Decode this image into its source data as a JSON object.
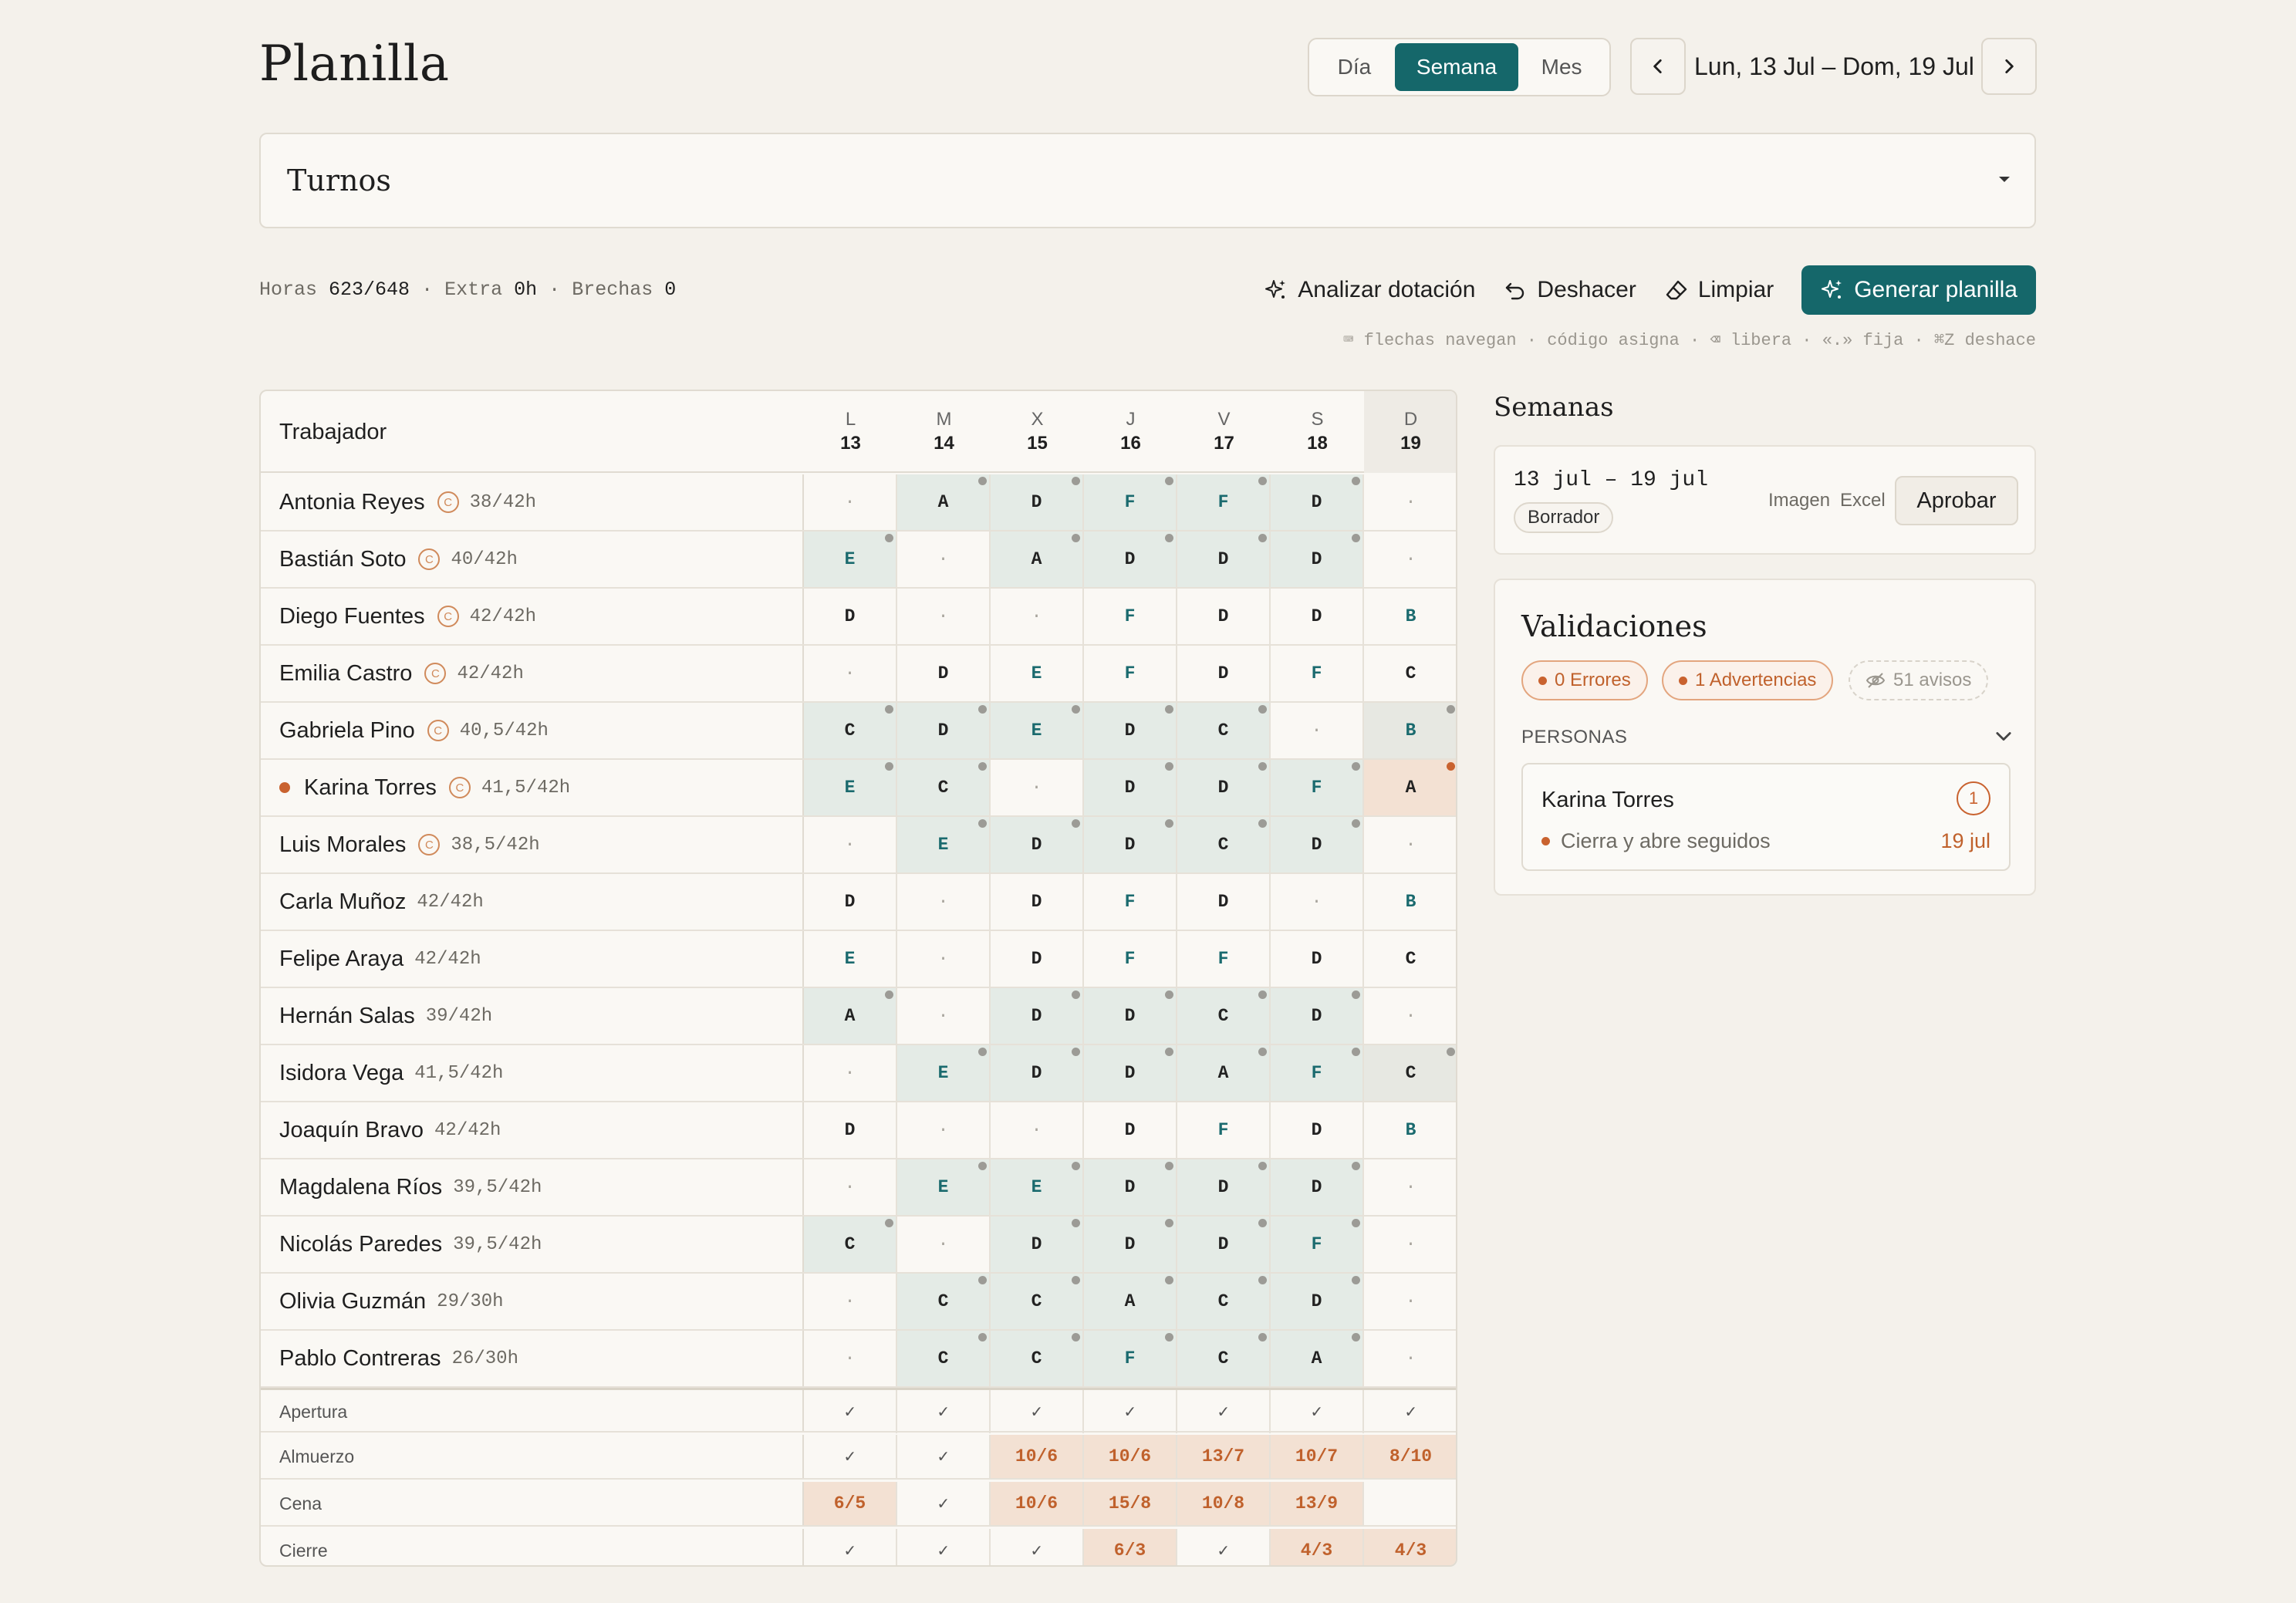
{
  "header": {
    "title": "Planilla",
    "view_options": [
      "Día",
      "Semana",
      "Mes"
    ],
    "selected_view": "Semana",
    "date_range": "Lun, 13 Jul – Dom, 19 Jul"
  },
  "turnos": {
    "label": "Turnos"
  },
  "stats": {
    "horas_label": "Horas",
    "horas_value": "623/648",
    "extra_label": "Extra",
    "extra_value": "0h",
    "brechas_label": "Brechas",
    "brechas_value": "0",
    "separator": "·"
  },
  "toolbar": {
    "analizar": "Analizar dotación",
    "deshacer": "Deshacer",
    "limpiar": "Limpiar",
    "generar": "Generar planilla",
    "hint": "⌨ flechas navegan · código asigna · ⌫ libera · «.» fija · ⌘Z deshace"
  },
  "grid": {
    "worker_header": "Trabajador",
    "days": [
      {
        "letter": "L",
        "num": "13"
      },
      {
        "letter": "M",
        "num": "14"
      },
      {
        "letter": "X",
        "num": "15"
      },
      {
        "letter": "J",
        "num": "16"
      },
      {
        "letter": "V",
        "num": "17"
      },
      {
        "letter": "S",
        "num": "18"
      },
      {
        "letter": "D",
        "num": "19"
      }
    ],
    "workers": [
      {
        "name": "Antonia Reyes",
        "contract": "C",
        "hours": "38/42h",
        "flag": false,
        "cells": [
          [
            "·",
            0,
            0,
            "e"
          ],
          [
            "A",
            1,
            1,
            "d"
          ],
          [
            "D",
            1,
            1,
            "d"
          ],
          [
            "F",
            1,
            1,
            "t"
          ],
          [
            "F",
            1,
            1,
            "t"
          ],
          [
            "D",
            1,
            1,
            "d"
          ],
          [
            "·",
            0,
            0,
            "e"
          ]
        ]
      },
      {
        "name": "Bastián Soto",
        "contract": "C",
        "hours": "40/42h",
        "flag": false,
        "cells": [
          [
            "E",
            1,
            1,
            "t"
          ],
          [
            "·",
            0,
            0,
            "e"
          ],
          [
            "A",
            1,
            1,
            "d"
          ],
          [
            "D",
            1,
            1,
            "d"
          ],
          [
            "D",
            1,
            1,
            "d"
          ],
          [
            "D",
            1,
            1,
            "d"
          ],
          [
            "·",
            0,
            0,
            "e"
          ]
        ]
      },
      {
        "name": "Diego Fuentes",
        "contract": "C",
        "hours": "42/42h",
        "flag": false,
        "cells": [
          [
            "D",
            0,
            0,
            "d"
          ],
          [
            "·",
            0,
            0,
            "e"
          ],
          [
            "·",
            0,
            0,
            "e"
          ],
          [
            "F",
            0,
            0,
            "t"
          ],
          [
            "D",
            0,
            0,
            "d"
          ],
          [
            "D",
            0,
            0,
            "d"
          ],
          [
            "B",
            0,
            0,
            "t"
          ]
        ]
      },
      {
        "name": "Emilia Castro",
        "contract": "C",
        "hours": "42/42h",
        "flag": false,
        "cells": [
          [
            "·",
            0,
            0,
            "e"
          ],
          [
            "D",
            0,
            0,
            "d"
          ],
          [
            "E",
            0,
            0,
            "t"
          ],
          [
            "F",
            0,
            0,
            "t"
          ],
          [
            "D",
            0,
            0,
            "d"
          ],
          [
            "F",
            0,
            0,
            "t"
          ],
          [
            "C",
            0,
            0,
            "d"
          ]
        ]
      },
      {
        "name": "Gabriela Pino",
        "contract": "C",
        "hours": "40,5/42h",
        "flag": false,
        "cells": [
          [
            "C",
            1,
            1,
            "d"
          ],
          [
            "D",
            1,
            1,
            "d"
          ],
          [
            "E",
            1,
            1,
            "t"
          ],
          [
            "D",
            1,
            1,
            "d"
          ],
          [
            "C",
            1,
            1,
            "d"
          ],
          [
            "·",
            0,
            0,
            "e"
          ],
          [
            "B",
            1,
            1,
            "t"
          ]
        ]
      },
      {
        "name": "Karina Torres",
        "contract": "C",
        "hours": "41,5/42h",
        "flag": true,
        "cells": [
          [
            "E",
            1,
            1,
            "t"
          ],
          [
            "C",
            1,
            1,
            "d"
          ],
          [
            "·",
            0,
            0,
            "e"
          ],
          [
            "D",
            1,
            1,
            "d"
          ],
          [
            "D",
            1,
            1,
            "d"
          ],
          [
            "F",
            1,
            1,
            "t"
          ],
          [
            "A",
            2,
            2,
            "d"
          ]
        ]
      },
      {
        "name": "Luis Morales",
        "contract": "C",
        "hours": "38,5/42h",
        "flag": false,
        "cells": [
          [
            "·",
            0,
            0,
            "e"
          ],
          [
            "E",
            1,
            1,
            "t"
          ],
          [
            "D",
            1,
            1,
            "d"
          ],
          [
            "D",
            1,
            1,
            "d"
          ],
          [
            "C",
            1,
            1,
            "d"
          ],
          [
            "D",
            1,
            1,
            "d"
          ],
          [
            "·",
            0,
            0,
            "e"
          ]
        ]
      },
      {
        "name": "Carla Muñoz",
        "contract": "",
        "hours": "42/42h",
        "flag": false,
        "cells": [
          [
            "D",
            0,
            0,
            "d"
          ],
          [
            "·",
            0,
            0,
            "e"
          ],
          [
            "D",
            0,
            0,
            "d"
          ],
          [
            "F",
            0,
            0,
            "t"
          ],
          [
            "D",
            0,
            0,
            "d"
          ],
          [
            "·",
            0,
            0,
            "e"
          ],
          [
            "B",
            0,
            0,
            "t"
          ]
        ]
      },
      {
        "name": "Felipe Araya",
        "contract": "",
        "hours": "42/42h",
        "flag": false,
        "cells": [
          [
            "E",
            0,
            0,
            "t"
          ],
          [
            "·",
            0,
            0,
            "e"
          ],
          [
            "D",
            0,
            0,
            "d"
          ],
          [
            "F",
            0,
            0,
            "t"
          ],
          [
            "F",
            0,
            0,
            "t"
          ],
          [
            "D",
            0,
            0,
            "d"
          ],
          [
            "C",
            0,
            0,
            "d"
          ]
        ]
      },
      {
        "name": "Hernán Salas",
        "contract": "",
        "hours": "39/42h",
        "flag": false,
        "cells": [
          [
            "A",
            1,
            1,
            "d"
          ],
          [
            "·",
            0,
            0,
            "e"
          ],
          [
            "D",
            1,
            1,
            "d"
          ],
          [
            "D",
            1,
            1,
            "d"
          ],
          [
            "C",
            1,
            1,
            "d"
          ],
          [
            "D",
            1,
            1,
            "d"
          ],
          [
            "·",
            0,
            0,
            "e"
          ]
        ]
      },
      {
        "name": "Isidora Vega",
        "contract": "",
        "hours": "41,5/42h",
        "flag": false,
        "cells": [
          [
            "·",
            0,
            0,
            "e"
          ],
          [
            "E",
            1,
            1,
            "t"
          ],
          [
            "D",
            1,
            1,
            "d"
          ],
          [
            "D",
            1,
            1,
            "d"
          ],
          [
            "A",
            1,
            1,
            "d"
          ],
          [
            "F",
            1,
            1,
            "t"
          ],
          [
            "C",
            1,
            1,
            "d"
          ]
        ]
      },
      {
        "name": "Joaquín Bravo",
        "contract": "",
        "hours": "42/42h",
        "flag": false,
        "cells": [
          [
            "D",
            0,
            0,
            "d"
          ],
          [
            "·",
            0,
            0,
            "e"
          ],
          [
            "·",
            0,
            0,
            "e"
          ],
          [
            "D",
            0,
            0,
            "d"
          ],
          [
            "F",
            0,
            0,
            "t"
          ],
          [
            "D",
            0,
            0,
            "d"
          ],
          [
            "B",
            0,
            0,
            "t"
          ]
        ]
      },
      {
        "name": "Magdalena Ríos",
        "contract": "",
        "hours": "39,5/42h",
        "flag": false,
        "cells": [
          [
            "·",
            0,
            0,
            "e"
          ],
          [
            "E",
            1,
            1,
            "t"
          ],
          [
            "E",
            1,
            1,
            "t"
          ],
          [
            "D",
            1,
            1,
            "d"
          ],
          [
            "D",
            1,
            1,
            "d"
          ],
          [
            "D",
            1,
            1,
            "d"
          ],
          [
            "·",
            0,
            0,
            "e"
          ]
        ]
      },
      {
        "name": "Nicolás Paredes",
        "contract": "",
        "hours": "39,5/42h",
        "flag": false,
        "cells": [
          [
            "C",
            1,
            1,
            "d"
          ],
          [
            "·",
            0,
            0,
            "e"
          ],
          [
            "D",
            1,
            1,
            "d"
          ],
          [
            "D",
            1,
            1,
            "d"
          ],
          [
            "D",
            1,
            1,
            "d"
          ],
          [
            "F",
            1,
            1,
            "t"
          ],
          [
            "·",
            0,
            0,
            "e"
          ]
        ]
      },
      {
        "name": "Olivia Guzmán",
        "contract": "",
        "hours": "29/30h",
        "flag": false,
        "cells": [
          [
            "·",
            0,
            0,
            "e"
          ],
          [
            "C",
            1,
            1,
            "d"
          ],
          [
            "C",
            1,
            1,
            "d"
          ],
          [
            "A",
            1,
            1,
            "d"
          ],
          [
            "C",
            1,
            1,
            "d"
          ],
          [
            "D",
            1,
            1,
            "d"
          ],
          [
            "·",
            0,
            0,
            "e"
          ]
        ]
      },
      {
        "name": "Pablo Contreras",
        "contract": "",
        "hours": "26/30h",
        "flag": false,
        "cells": [
          [
            "·",
            0,
            0,
            "e"
          ],
          [
            "C",
            1,
            1,
            "d"
          ],
          [
            "C",
            1,
            1,
            "d"
          ],
          [
            "F",
            1,
            1,
            "t"
          ],
          [
            "C",
            1,
            1,
            "d"
          ],
          [
            "A",
            1,
            1,
            "d"
          ],
          [
            "·",
            0,
            0,
            "e"
          ]
        ]
      }
    ],
    "coverage": [
      {
        "label": "Apertura",
        "values": [
          "✓",
          "✓",
          "✓",
          "✓",
          "✓",
          "✓",
          "✓"
        ],
        "short": [
          0,
          0,
          0,
          0,
          0,
          0,
          0
        ]
      },
      {
        "label": "Almuerzo",
        "values": [
          "✓",
          "✓",
          "10/6",
          "10/6",
          "13/7",
          "10/7",
          "8/10"
        ],
        "short": [
          0,
          0,
          1,
          1,
          1,
          1,
          1
        ]
      },
      {
        "label": "Cena",
        "values": [
          "6/5",
          "✓",
          "10/6",
          "15/8",
          "10/8",
          "13/9",
          ""
        ],
        "short": [
          1,
          0,
          1,
          1,
          1,
          1,
          0
        ]
      },
      {
        "label": "Cierre",
        "values": [
          "✓",
          "✓",
          "✓",
          "6/3",
          "✓",
          "4/3",
          "4/3"
        ],
        "short": [
          0,
          0,
          0,
          1,
          0,
          1,
          1
        ]
      }
    ]
  },
  "semanas": {
    "title": "Semanas",
    "range": "13 jul – 19 jul",
    "status": "Borrador",
    "imagen": "Imagen",
    "excel": "Excel",
    "aprobar": "Aprobar"
  },
  "validaciones": {
    "title": "Validaciones",
    "errores": "0 Errores",
    "advertencias": "1 Advertencias",
    "avisos": "51 avisos",
    "personas": "PERSONAS",
    "person": {
      "name": "Karina Torres",
      "count": "1",
      "issue": "Cierra y abre seguidos",
      "date": "19 jul"
    }
  },
  "colors": {
    "accent": "#15676a",
    "warning": "#c9622f",
    "background": "#f4f1eb"
  }
}
